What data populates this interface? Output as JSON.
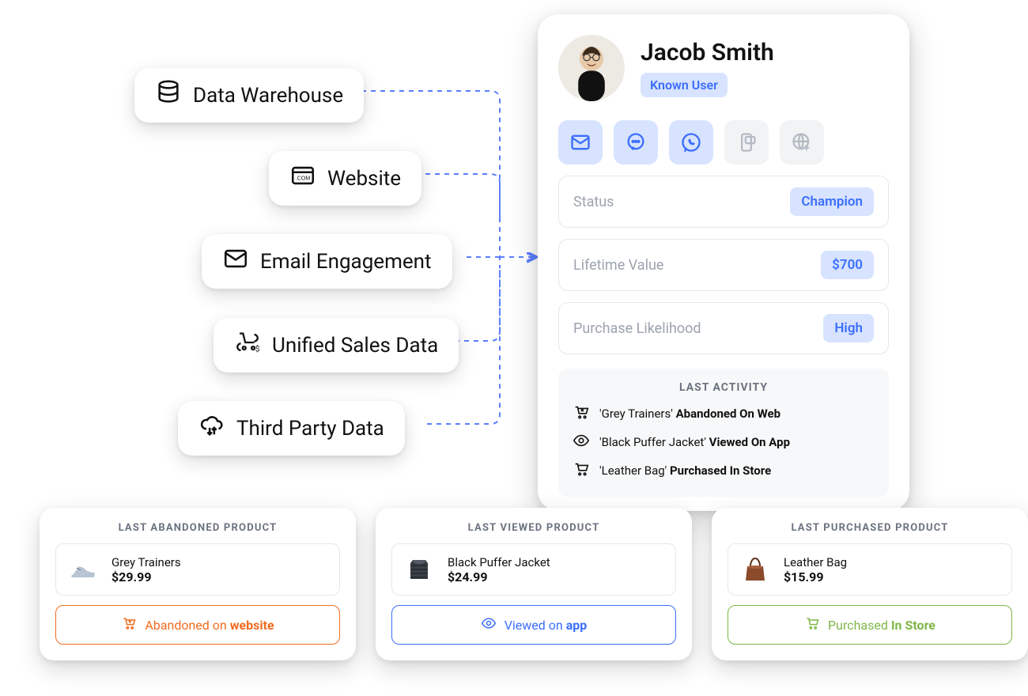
{
  "sources": [
    {
      "label": "Data Warehouse",
      "icon": "database-icon"
    },
    {
      "label": "Website",
      "icon": "website-icon"
    },
    {
      "label": "Email Engagement",
      "icon": "email-icon"
    },
    {
      "label": "Unified Sales Data",
      "icon": "sales-icon"
    },
    {
      "label": "Third Party Data",
      "icon": "cloud-sync-icon"
    }
  ],
  "profile": {
    "name": "Jacob Smith",
    "user_type": "Known User",
    "channels": [
      {
        "name": "email-icon",
        "enabled": true
      },
      {
        "name": "chat-icon",
        "enabled": true
      },
      {
        "name": "whatsapp-icon",
        "enabled": true
      },
      {
        "name": "push-icon",
        "enabled": false
      },
      {
        "name": "web-icon",
        "enabled": false
      }
    ],
    "stats": [
      {
        "label": "Status",
        "value": "Champion"
      },
      {
        "label": "Lifetime Value",
        "value": "$700"
      },
      {
        "label": "Purchase Likelihood",
        "value": "High"
      }
    ],
    "last_activity_title": "LAST ACTIVITY",
    "last_activity": [
      {
        "icon": "cart-x-icon",
        "product": "Grey Trainers",
        "action": "Abandoned On Web"
      },
      {
        "icon": "eye-icon",
        "product": "Black Puffer Jacket",
        "action": "Viewed On App"
      },
      {
        "icon": "cart-icon",
        "product": "Leather Bag",
        "action": "Purchased In Store"
      }
    ]
  },
  "product_cards": [
    {
      "heading": "LAST ABANDONED PRODUCT",
      "product_name": "Grey Trainers",
      "price": "$29.99",
      "action_prefix": "Abandoned on ",
      "action_bold": "website",
      "color": "orange",
      "icon": "cart-x-icon",
      "thumb": "sneaker"
    },
    {
      "heading": "LAST VIEWED PRODUCT",
      "product_name": "Black Puffer Jacket",
      "price": "$24.99",
      "action_prefix": "Viewed on ",
      "action_bold": "app",
      "color": "blue",
      "icon": "eye-icon",
      "thumb": "jacket"
    },
    {
      "heading": "LAST PURCHASED PRODUCT",
      "product_name": "Leather Bag",
      "price": "$15.99",
      "action_prefix": "Purchased ",
      "action_bold": "In Store",
      "color": "green",
      "icon": "cart-icon",
      "thumb": "bag"
    }
  ]
}
